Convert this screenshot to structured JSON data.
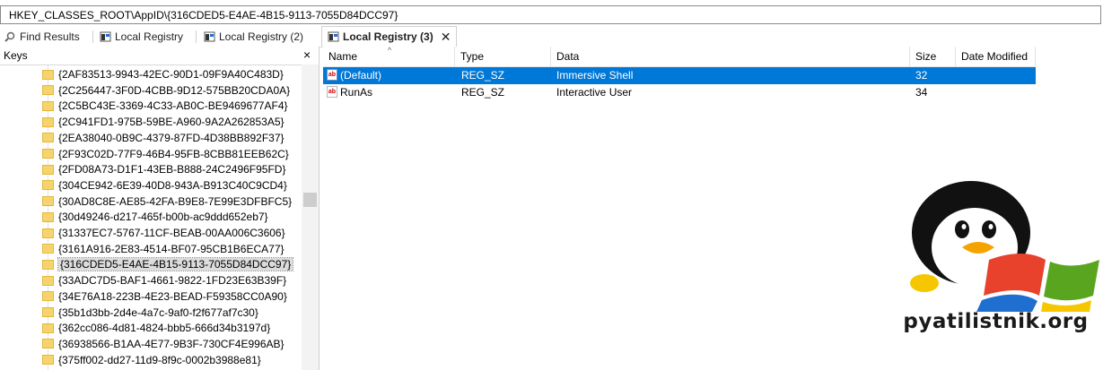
{
  "address": {
    "path": "HKEY_CLASSES_ROOT\\AppID\\{316CDED5-E4AE-4B15-9113-7055D84DCC97}"
  },
  "tabs": [
    {
      "label": "Find Results",
      "icon": "magnifier-icon"
    },
    {
      "label": "Local Registry",
      "icon": "registry-icon"
    },
    {
      "label": "Local Registry (2)",
      "icon": "registry-icon"
    },
    {
      "label": "Local Registry (3)",
      "icon": "registry-icon",
      "active": true,
      "close": "✕"
    }
  ],
  "keys_panel": {
    "title": "Keys",
    "close": "×",
    "items": [
      "{2AF83513-9943-42EC-90D1-09F9A40C483D}",
      "{2C256447-3F0D-4CBB-9D12-575BB20CDA0A}",
      "{2C5BC43E-3369-4C33-AB0C-BE9469677AF4}",
      "{2C941FD1-975B-59BE-A960-9A2A262853A5}",
      "{2EA38040-0B9C-4379-87FD-4D38BB892F37}",
      "{2F93C02D-77F9-46B4-95FB-8CBB81EEB62C}",
      "{2FD08A73-D1F1-43EB-B888-24C2496F95FD}",
      "{304CE942-6E39-40D8-943A-B913C40C9CD4}",
      "{30AD8C8E-AE85-42FA-B9E8-7E99E3DFBFC5}",
      "{30d49246-d217-465f-b00b-ac9ddd652eb7}",
      "{31337EC7-5767-11CF-BEAB-00AA006C3606}",
      "{3161A916-2E83-4514-BF07-95CB1B6ECA77}",
      "{316CDED5-E4AE-4B15-9113-7055D84DCC97}",
      "{33ADC7D5-BAF1-4661-9822-1FD23E63B39F}",
      "{34E76A18-223B-4E23-BEAD-F59358CC0A90}",
      "{35b1d3bb-2d4e-4a7c-9af0-f2f677af7c30}",
      "{362cc086-4d81-4824-bbb5-666d34b3197d}",
      "{36938566-B1AA-4E77-9B3F-730CF4E996AB}",
      "{375ff002-dd27-11d9-8f9c-0002b3988e81}"
    ],
    "selected_index": 12
  },
  "values_panel": {
    "columns": [
      "Name",
      "Type",
      "Data",
      "Size",
      "Date Modified"
    ],
    "rows": [
      {
        "icon": "ab",
        "name": "(Default)",
        "type": "REG_SZ",
        "data": "Immersive Shell",
        "size": "32",
        "date": ""
      },
      {
        "icon": "ab",
        "name": "RunAs",
        "type": "REG_SZ",
        "data": "Interactive User",
        "size": "34",
        "date": ""
      }
    ],
    "selected_row": 0
  },
  "watermark": {
    "text": "pyatilistnik.org",
    "icon": "penguin-windows-logo"
  },
  "colors": {
    "selection": "#0078d7",
    "folder": "#f6d46b",
    "accent_red": "#e8412c",
    "accent_green": "#5aa51f",
    "accent_blue": "#1e6fd0",
    "accent_yellow": "#f6c700"
  }
}
